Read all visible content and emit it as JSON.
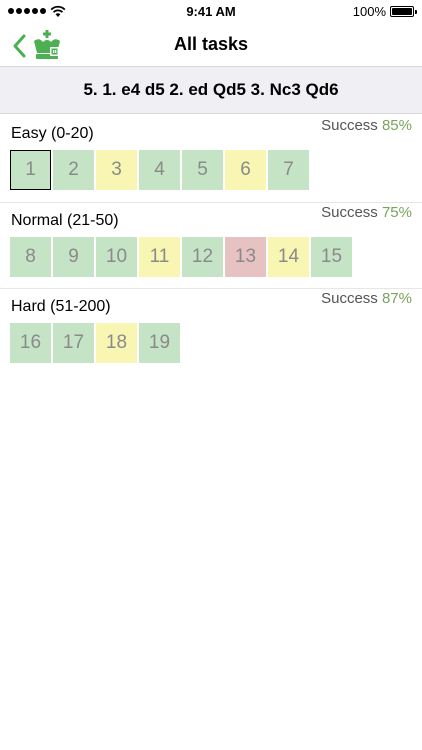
{
  "status_bar": {
    "time": "9:41 AM",
    "battery": "100%"
  },
  "nav": {
    "title": "All tasks",
    "back_icon": "chevron-left-icon",
    "logo_icon": "chess-king-logo-icon"
  },
  "lesson": {
    "title": "5. 1. e4 d5 2. ed Qd5 3. Nc3 Qd6"
  },
  "colors": {
    "accent": "#4caf50",
    "solved": "#c5e3c5",
    "partial": "#f8f6b2",
    "failed": "#e6c2c2",
    "success_pct": "#7aa35c"
  },
  "sections": [
    {
      "title": "Easy (0-20)",
      "success_label": "Success",
      "success_value": "85%",
      "tasks": [
        {
          "n": "1",
          "status": "green",
          "selected": true
        },
        {
          "n": "2",
          "status": "green"
        },
        {
          "n": "3",
          "status": "yellow"
        },
        {
          "n": "4",
          "status": "green"
        },
        {
          "n": "5",
          "status": "green"
        },
        {
          "n": "6",
          "status": "yellow"
        },
        {
          "n": "7",
          "status": "green"
        }
      ]
    },
    {
      "title": "Normal (21-50)",
      "success_label": "Success",
      "success_value": "75%",
      "tasks": [
        {
          "n": "8",
          "status": "green"
        },
        {
          "n": "9",
          "status": "green"
        },
        {
          "n": "10",
          "status": "green"
        },
        {
          "n": "11",
          "status": "yellow"
        },
        {
          "n": "12",
          "status": "green"
        },
        {
          "n": "13",
          "status": "red"
        },
        {
          "n": "14",
          "status": "yellow"
        },
        {
          "n": "15",
          "status": "green"
        }
      ]
    },
    {
      "title": "Hard (51-200)",
      "success_label": "Success",
      "success_value": "87%",
      "tasks": [
        {
          "n": "16",
          "status": "green"
        },
        {
          "n": "17",
          "status": "green"
        },
        {
          "n": "18",
          "status": "yellow"
        },
        {
          "n": "19",
          "status": "green"
        }
      ]
    }
  ]
}
